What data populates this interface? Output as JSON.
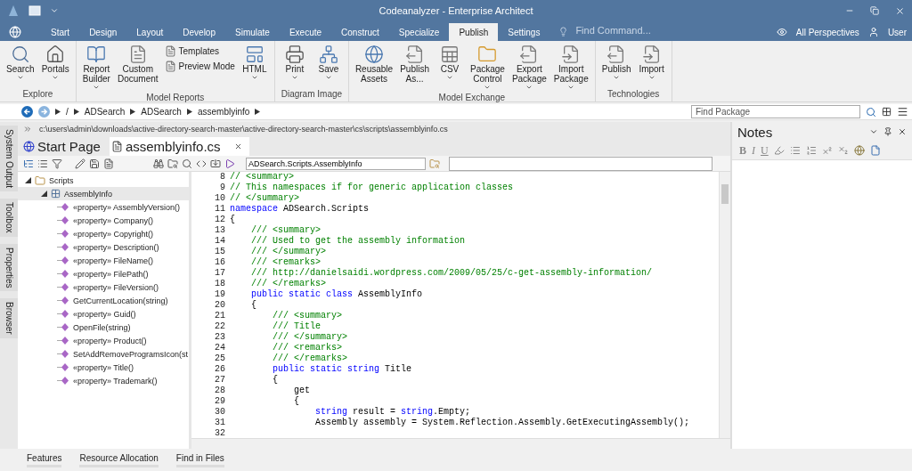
{
  "window": {
    "title": "Codeanalyzer - Enterprise Architect"
  },
  "ribbon_tabs": [
    {
      "label": "Start",
      "selected": false
    },
    {
      "label": "Design",
      "selected": false
    },
    {
      "label": "Layout",
      "selected": false
    },
    {
      "label": "Develop",
      "selected": false
    },
    {
      "label": "Simulate",
      "selected": false
    },
    {
      "label": "Execute",
      "selected": false
    },
    {
      "label": "Construct",
      "selected": false
    },
    {
      "label": "Specialize",
      "selected": false
    },
    {
      "label": "Publish",
      "selected": true
    },
    {
      "label": "Settings",
      "selected": false
    }
  ],
  "find_command": {
    "placeholder": "Find Command..."
  },
  "perspectives": "All Perspectives",
  "user": "User",
  "ribbon_groups": [
    {
      "label": "Explore",
      "items": [
        {
          "kind": "large",
          "label": "Search",
          "dropdown": true
        },
        {
          "kind": "large",
          "label": "Portals",
          "dropdown": true
        }
      ]
    },
    {
      "label": "Model Reports",
      "items": [
        {
          "kind": "large",
          "label": "Report\nBuilder",
          "dropdown": true
        },
        {
          "kind": "large",
          "label": "Custom\nDocument",
          "dropdown": false
        },
        {
          "kind": "stack",
          "items": [
            {
              "label": "Templates"
            },
            {
              "label": "Preview Mode"
            }
          ]
        },
        {
          "kind": "large",
          "label": "HTML",
          "dropdown": true
        }
      ]
    },
    {
      "label": "Diagram Image",
      "items": [
        {
          "kind": "large",
          "label": "Print",
          "dropdown": true
        },
        {
          "kind": "large",
          "label": "Save",
          "dropdown": true
        }
      ]
    },
    {
      "label": "Model Exchange",
      "items": [
        {
          "kind": "large",
          "label": "Reusable\nAssets",
          "dropdown": false
        },
        {
          "kind": "large",
          "label": "Publish\nAs...",
          "dropdown": false
        },
        {
          "kind": "large",
          "label": "CSV",
          "dropdown": true
        },
        {
          "kind": "large",
          "label": "Package\nControl",
          "dropdown": true
        },
        {
          "kind": "large",
          "label": "Export\nPackage",
          "dropdown": true
        },
        {
          "kind": "large",
          "label": "Import\nPackage",
          "dropdown": true
        }
      ]
    },
    {
      "label": "Technologies",
      "items": [
        {
          "kind": "large",
          "label": "Publish",
          "dropdown": true
        },
        {
          "kind": "large",
          "label": "Import",
          "dropdown": true
        }
      ]
    }
  ],
  "breadcrumb": [
    "/",
    "ADSearch",
    "ADSearch",
    "assemblyinfo"
  ],
  "find_package": {
    "placeholder": "Find Package"
  },
  "side_tabs": [
    "System Output",
    "Toolbox",
    "Properties",
    "Browser"
  ],
  "file_path": "c:\\users\\admin\\downloads\\active-directory-search-master\\active-directory-search-master\\cs\\scripts\\assemblyinfo.cs",
  "document_tabs": [
    {
      "label": "Start Page",
      "selected": false
    },
    {
      "label": "assemblyinfo.cs",
      "selected": true
    }
  ],
  "scope_field": {
    "value": "ADSearch.Scripts.AssemblyInfo"
  },
  "tree": [
    {
      "label": "Scripts",
      "kind": "folder",
      "expanded": true,
      "selected": false,
      "children": [
        {
          "label": "AssemblyInfo",
          "kind": "class",
          "expanded": true,
          "selected": true,
          "children": [
            {
              "label": "«property» AssemblyVersion()",
              "kind": "member",
              "selected": false
            },
            {
              "label": "«property» Company()",
              "kind": "member",
              "selected": false
            },
            {
              "label": "«property» Copyright()",
              "kind": "member",
              "selected": false
            },
            {
              "label": "«property» Description()",
              "kind": "member",
              "selected": false
            },
            {
              "label": "«property» FileName()",
              "kind": "member",
              "selected": false
            },
            {
              "label": "«property» FilePath()",
              "kind": "member",
              "selected": false
            },
            {
              "label": "«property» FileVersion()",
              "kind": "member",
              "selected": false
            },
            {
              "label": "GetCurrentLocation(string)",
              "kind": "member",
              "selected": false
            },
            {
              "label": "«property» Guid()",
              "kind": "member",
              "selected": false
            },
            {
              "label": "OpenFile(string)",
              "kind": "member",
              "selected": false
            },
            {
              "label": "«property» Product()",
              "kind": "member",
              "selected": false
            },
            {
              "label": "SetAddRemoveProgramsIcon(st",
              "kind": "member",
              "selected": false
            },
            {
              "label": "«property» Title()",
              "kind": "member",
              "selected": false
            },
            {
              "label": "«property» Trademark()",
              "kind": "member",
              "selected": false
            }
          ]
        }
      ]
    }
  ],
  "code_lines": [
    {
      "number": "8",
      "tokens": [
        {
          "text": "// <summary>",
          "kind": "comment"
        }
      ]
    },
    {
      "number": "9",
      "tokens": [
        {
          "text": "// This namespaces if for generic application classes",
          "kind": "comment"
        }
      ]
    },
    {
      "number": "10",
      "tokens": [
        {
          "text": "// </summary>",
          "kind": "comment"
        }
      ]
    },
    {
      "number": "11",
      "tokens": [
        {
          "text": "namespace",
          "kind": "keyword"
        },
        {
          "text": " ADSearch.Scripts",
          "kind": "plain"
        }
      ]
    },
    {
      "number": "12",
      "tokens": [
        {
          "text": "{",
          "kind": "plain"
        }
      ]
    },
    {
      "number": "13",
      "tokens": [
        {
          "text": "    /// <summary>",
          "kind": "comment"
        }
      ]
    },
    {
      "number": "14",
      "tokens": [
        {
          "text": "    /// Used to get the assembly information",
          "kind": "comment"
        }
      ]
    },
    {
      "number": "15",
      "tokens": [
        {
          "text": "    /// </summary>",
          "kind": "comment"
        }
      ]
    },
    {
      "number": "16",
      "tokens": [
        {
          "text": "    /// <remarks>",
          "kind": "comment"
        }
      ]
    },
    {
      "number": "17",
      "tokens": [
        {
          "text": "    /// http://danielsaidi.wordpress.com/2009/05/25/c-get-assembly-information/",
          "kind": "comment"
        }
      ]
    },
    {
      "number": "18",
      "tokens": [
        {
          "text": "    /// </remarks>",
          "kind": "comment"
        }
      ]
    },
    {
      "number": "19",
      "tokens": [
        {
          "text": "    public static class",
          "kind": "keyword"
        },
        {
          "text": " AssemblyInfo",
          "kind": "plain"
        }
      ]
    },
    {
      "number": "20",
      "tokens": [
        {
          "text": "    {",
          "kind": "plain"
        }
      ]
    },
    {
      "number": "21",
      "tokens": [
        {
          "text": "        /// <summary>",
          "kind": "comment"
        }
      ]
    },
    {
      "number": "22",
      "tokens": [
        {
          "text": "        /// Title",
          "kind": "comment"
        }
      ]
    },
    {
      "number": "23",
      "tokens": [
        {
          "text": "        /// </summary>",
          "kind": "comment"
        }
      ]
    },
    {
      "number": "24",
      "tokens": [
        {
          "text": "        /// <remarks>",
          "kind": "comment"
        }
      ]
    },
    {
      "number": "25",
      "tokens": [
        {
          "text": "        /// </remarks>",
          "kind": "comment"
        }
      ]
    },
    {
      "number": "26",
      "tokens": [
        {
          "text": "        public static string",
          "kind": "keyword"
        },
        {
          "text": " Title",
          "kind": "plain"
        }
      ]
    },
    {
      "number": "27",
      "tokens": [
        {
          "text": "        {",
          "kind": "plain"
        }
      ]
    },
    {
      "number": "28",
      "tokens": [
        {
          "text": "            get",
          "kind": "plain"
        }
      ]
    },
    {
      "number": "29",
      "tokens": [
        {
          "text": "            {",
          "kind": "plain"
        }
      ]
    },
    {
      "number": "30",
      "tokens": [
        {
          "text": "                string",
          "kind": "keyword"
        },
        {
          "text": " result = ",
          "kind": "plain"
        },
        {
          "text": "string",
          "kind": "keyword"
        },
        {
          "text": ".Empty;",
          "kind": "plain"
        }
      ]
    },
    {
      "number": "31",
      "tokens": [
        {
          "text": "                Assembly assembly = System.Reflection.Assembly.GetExecutingAssembly();",
          "kind": "plain"
        }
      ]
    },
    {
      "number": "32"
    }
  ],
  "notes": {
    "title": "Notes",
    "format_buttons": [
      "B",
      "I",
      "U"
    ]
  },
  "bottom_tabs": [
    {
      "label": "Features",
      "selected": false
    },
    {
      "label": "Resource Allocation",
      "selected": false
    },
    {
      "label": "Find in Files",
      "selected": false
    }
  ]
}
